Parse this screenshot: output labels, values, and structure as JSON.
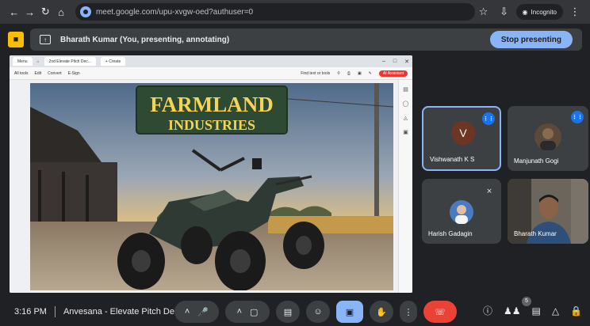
{
  "browser": {
    "url": "meet.google.com/upu-xvgw-oed?authuser=0",
    "incognito_label": "Incognito"
  },
  "present_bar": {
    "status": "Bharath Kumar (You, presenting, annotating)",
    "stop_label": "Stop presenting"
  },
  "shared_window": {
    "tabs": [
      "Menu",
      "2nd Elevate Pitch Dec...",
      "+ Create"
    ],
    "toolbar": [
      "All tools",
      "Edit",
      "Convert",
      "E-Sign"
    ],
    "find_label": "Find text or tools",
    "ai_label": "AI Assistant",
    "slide_title_1": "FARMLAND",
    "slide_title_2": "INDUSTRIES"
  },
  "participants": [
    {
      "name": "Vishwanath K S",
      "initial": "V",
      "speaking": true
    },
    {
      "name": "Manjunath Gogi",
      "speaking": true
    },
    {
      "name": "Harish Gadagin",
      "muted": true
    },
    {
      "name": "Bharath Kumar"
    }
  ],
  "bottom": {
    "time": "3:16 PM",
    "meeting_title": "Anvesana - Elevate Pitch Dec...",
    "people_count": "5"
  },
  "colors": {
    "background": "#202124",
    "accent": "#8ab4f8",
    "hangup": "#ea4335",
    "speaking": "#1a73e8"
  }
}
